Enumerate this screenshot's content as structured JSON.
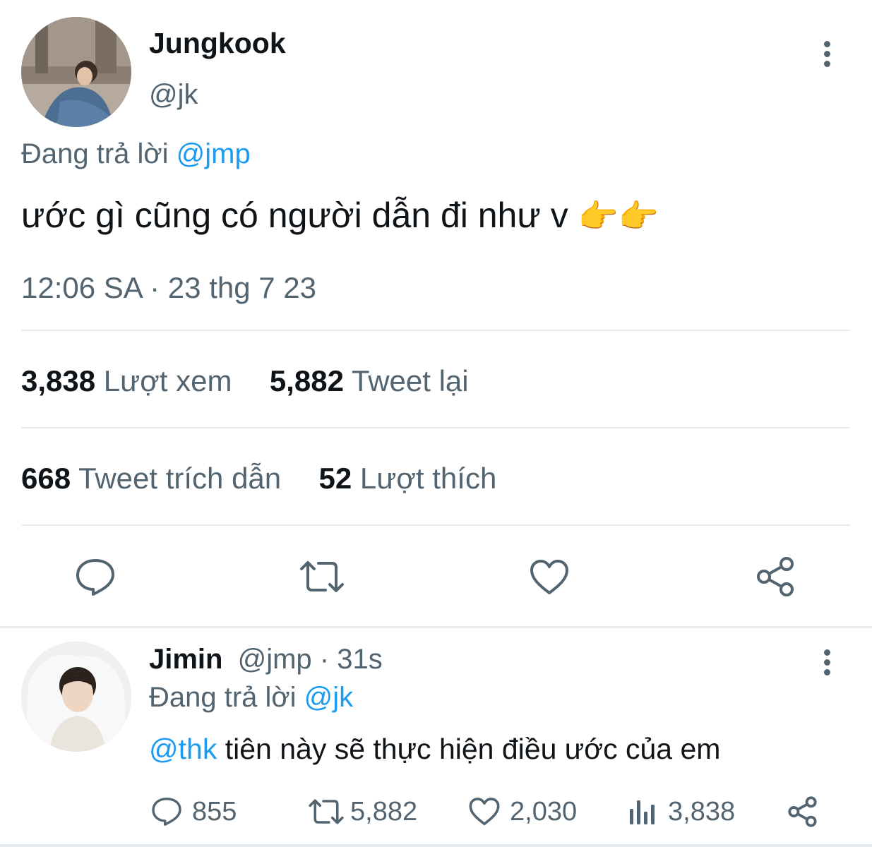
{
  "main_tweet": {
    "author_name": "Jungkook",
    "author_handle": "@jk",
    "reply_prefix": "Đang trả lời",
    "reply_to": "@jmp",
    "text": "ước gì cũng có người dẫn đi như v",
    "emoji": "👉👉",
    "timestamp": "12:06 SA · 23 thg 7 23",
    "stats": {
      "views_count": "3,838",
      "views_label": "Lượt xem",
      "retweets_count": "5,882",
      "retweets_label": "Tweet lại",
      "quotes_count": "668",
      "quotes_label": "Tweet trích dẫn",
      "likes_count": "52",
      "likes_label": "Lượt thích"
    }
  },
  "reply_tweet": {
    "author_name": "Jimin",
    "author_handle": "@jmp",
    "time": "· 31s",
    "reply_prefix": "Đang trả lời",
    "reply_to": "@jk",
    "mention": "@thk",
    "text": "tiên này sẽ thực hiện điều ước của em",
    "counts": {
      "replies": "855",
      "retweets": "5,882",
      "likes": "2,030",
      "views": "3,838"
    }
  },
  "icons": {
    "reply": "comment-icon",
    "retweet": "retweet-icon",
    "like": "heart-icon",
    "share": "share-icon",
    "views": "views-icon",
    "more": "more-vertical-icon"
  },
  "colors": {
    "link": "#1d9bf0",
    "muted": "#536471",
    "text": "#0f1419",
    "divider": "#e6ecf0"
  }
}
